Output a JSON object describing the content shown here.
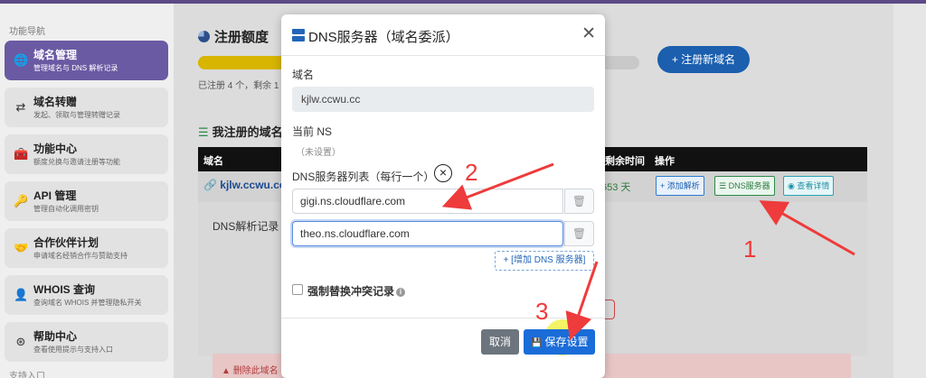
{
  "sidebar": {
    "title": "功能导航",
    "items": [
      {
        "label": "域名管理",
        "sub": "管理域名与 DNS 解析记录",
        "icon": "globe-icon",
        "glyph": "🌐",
        "active": true
      },
      {
        "label": "域名转赠",
        "sub": "发起、领取与管理转赠记录",
        "icon": "transfer-icon",
        "glyph": "⇄",
        "active": false
      },
      {
        "label": "功能中心",
        "sub": "额度兑换与邀请注册等功能",
        "icon": "toolbox-icon",
        "glyph": "🧰",
        "active": false
      },
      {
        "label": "API 管理",
        "sub": "管理自动化调用密钥",
        "icon": "key-icon",
        "glyph": "🔑",
        "active": false
      },
      {
        "label": "合作伙伴计划",
        "sub": "申请域名经销合作与赞助支持",
        "icon": "handshake-icon",
        "glyph": "🤝",
        "active": false
      },
      {
        "label": "WHOIS 查询",
        "sub": "查询域名 WHOIS 并管理隐私开关",
        "icon": "user-search-icon",
        "glyph": "👤",
        "active": false
      },
      {
        "label": "帮助中心",
        "sub": "查看使用提示与支持入口",
        "icon": "lifebuoy-icon",
        "glyph": "⊛",
        "active": false
      }
    ],
    "footer": "支持入口"
  },
  "quota": {
    "title": "注册额度",
    "text": "已注册 4 个，剩余 1",
    "fill_fraction": 0.8,
    "register_button": "+ 注册新域名"
  },
  "my_domains": {
    "title": "我注册的域名",
    "headers": {
      "domain": "域名",
      "remaining": "剩余时间",
      "actions": "操作"
    },
    "row": {
      "domain": "kjlw.ccwu.cc",
      "remaining": "653 天",
      "actions": {
        "add": "+ 添加解析",
        "dns": "DNS服务器",
        "view": "查看详情"
      }
    },
    "dns_records_label": "DNS解析记录",
    "delete_warning": "删除此域名"
  },
  "modal": {
    "title": "DNS服务器（域名委派）",
    "domain_label": "域名",
    "domain_value": "kjlw.ccwu.cc",
    "current_ns_label": "当前 NS",
    "current_ns_value": "（未设置）",
    "ns_list_label": "DNS服务器列表（每行一个）",
    "ns_entries": [
      "gigi.ns.cloudflare.com",
      "theo.ns.cloudflare.com"
    ],
    "add_ns": "+ [增加 DNS 服务器]",
    "force_replace_label": "强制替换冲突记录",
    "cancel": "取消",
    "save": "保存设置"
  },
  "annotations": {
    "one": "1",
    "two": "2",
    "three": "3",
    "color": "#ee3b3b"
  }
}
